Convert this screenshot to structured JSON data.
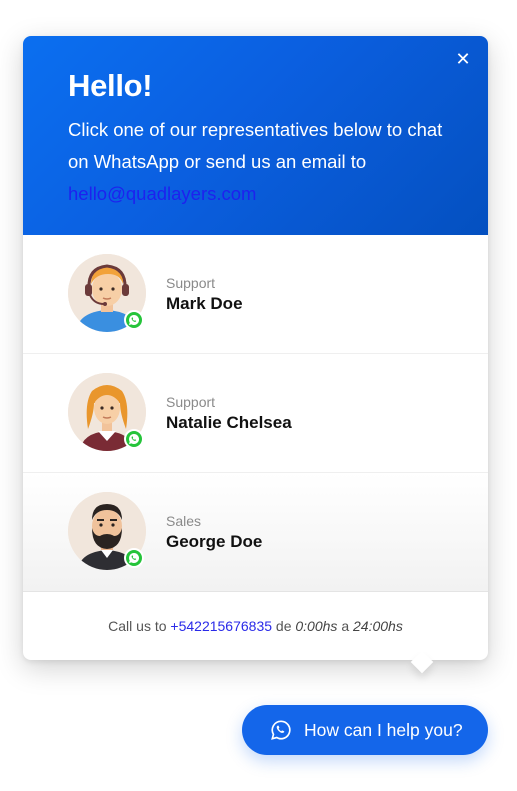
{
  "header": {
    "title": "Hello!",
    "intro": "Click one of our representatives below to chat on WhatsApp or send us an email to",
    "email": "hello@quadlayers.com",
    "close_icon": "close-icon"
  },
  "agents": [
    {
      "role": "Support",
      "name": "Mark Doe",
      "avatar": "man-headset-avatar"
    },
    {
      "role": "Support",
      "name": "Natalie Chelsea",
      "avatar": "woman-avatar"
    },
    {
      "role": "Sales",
      "name": "George Doe",
      "avatar": "bearded-man-avatar"
    }
  ],
  "footer": {
    "prefix": "Call us to",
    "phone": "+542215676835",
    "de": "de",
    "start": "0:00hs",
    "a": "a",
    "end": "24:00hs"
  },
  "cta": {
    "label": "How can I help you?",
    "icon": "whatsapp-icon"
  },
  "colors": {
    "primary": "#1466ea",
    "whatsapp": "#25c43a",
    "link": "#1d22ee"
  }
}
